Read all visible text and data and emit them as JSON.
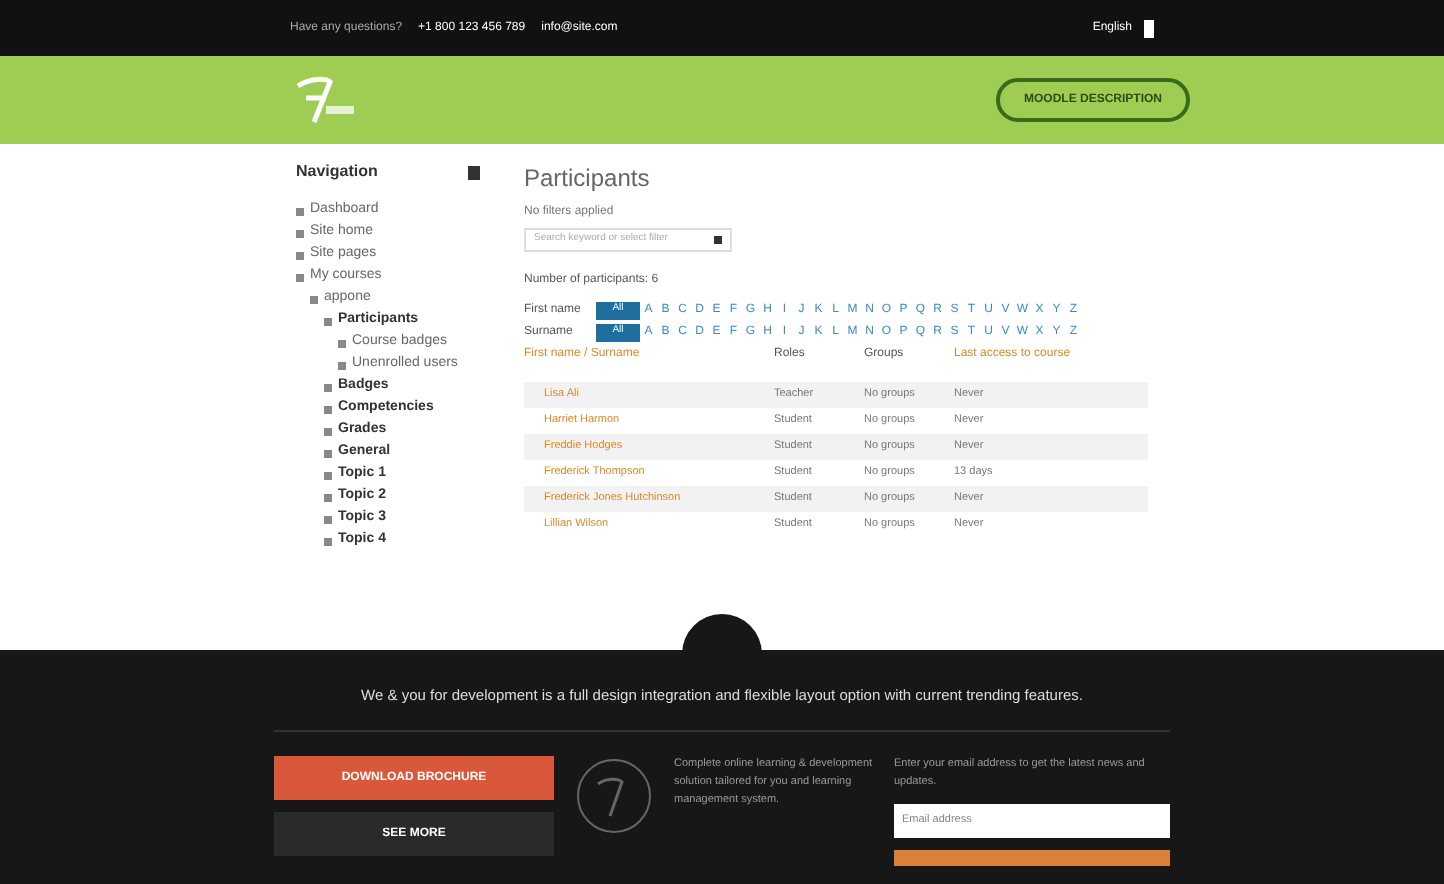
{
  "top_bar": {
    "question": "Have any questions?",
    "phone": "+1 800 123 456 789",
    "email": "info@site.com",
    "language": "English"
  },
  "header": {
    "button": "MOODLE DESCRIPTION"
  },
  "navigation": {
    "title": "Navigation",
    "items": [
      {
        "label": "Dashboard"
      },
      {
        "label": "Site home"
      },
      {
        "label": "Site pages"
      },
      {
        "label": "My courses",
        "children": [
          {
            "label": "appone",
            "children": [
              {
                "label": "Participants",
                "children": [
                  {
                    "label": "Course badges"
                  },
                  {
                    "label": "Unenrolled users"
                  }
                ]
              },
              {
                "label": "Badges"
              },
              {
                "label": "Competencies"
              },
              {
                "label": "Grades"
              },
              {
                "label": "General"
              },
              {
                "label": "Topic 1"
              },
              {
                "label": "Topic 2"
              },
              {
                "label": "Topic 3"
              },
              {
                "label": "Topic 4"
              }
            ]
          }
        ]
      }
    ]
  },
  "main": {
    "title": "Participants",
    "filter_label": "No filters applied",
    "filter_placeholder": "Search keyword or select filter",
    "count": "Number of participants: 6",
    "initials": [
      {
        "label": "First name",
        "all": "All",
        "letters": [
          "A",
          "B",
          "C",
          "D",
          "E",
          "F",
          "G",
          "H",
          "I",
          "J",
          "K",
          "L",
          "M",
          "N",
          "O",
          "P",
          "Q",
          "R",
          "S",
          "T",
          "U",
          "V",
          "W",
          "X",
          "Y",
          "Z"
        ]
      },
      {
        "label": "Surname",
        "all": "All",
        "letters": [
          "A",
          "B",
          "C",
          "D",
          "E",
          "F",
          "G",
          "H",
          "I",
          "J",
          "K",
          "L",
          "M",
          "N",
          "O",
          "P",
          "Q",
          "R",
          "S",
          "T",
          "U",
          "V",
          "W",
          "X",
          "Y",
          "Z"
        ]
      }
    ],
    "columns": [
      "First name / Surname",
      "Roles",
      "Groups",
      "Last access to course"
    ],
    "rows": [
      [
        "Lisa Ali",
        "Teacher",
        "No groups",
        "Never"
      ],
      [
        "Harriet Harmon",
        "Student",
        "No groups",
        "Never"
      ],
      [
        "Freddie Hodges",
        "Student",
        "No groups",
        "Never"
      ],
      [
        "Frederick Thompson",
        "Student",
        "No groups",
        "13 days"
      ],
      [
        "Frederick Jones Hutchinson",
        "Student",
        "No groups",
        "Never"
      ],
      [
        "Lillian Wilson",
        "Student",
        "No groups",
        "Never"
      ]
    ]
  },
  "footer": {
    "tagline": "We & you for development is a full design integration and flexible layout option with current trending features.",
    "download": "DOWNLOAD BROCHURE",
    "see_more": "SEE MORE",
    "about": "Complete online learning & development solution tailored for you and learning management system.",
    "newsletter": "Enter your email address to get the latest news and updates.",
    "email_placeholder": "Email address"
  }
}
